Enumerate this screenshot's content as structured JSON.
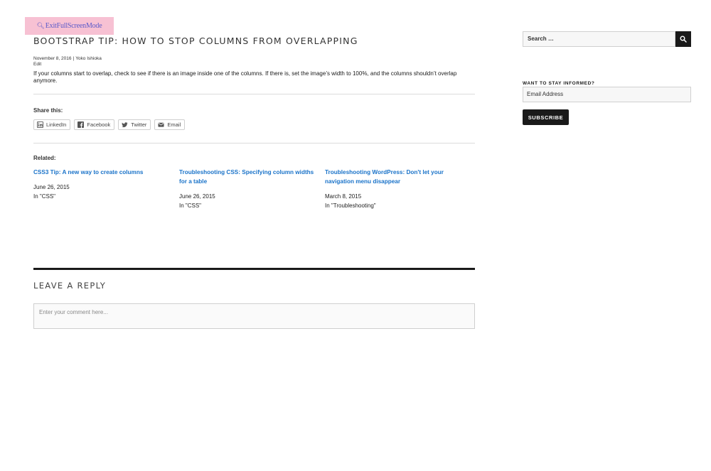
{
  "fullscreen": {
    "label": "ExitFullScreenMode"
  },
  "post": {
    "title": "BOOTSTRAP TIP: HOW TO STOP COLUMNS FROM OVERLAPPING",
    "date": "November 8, 2016",
    "author": "Yoko Ishioka",
    "meta_separator": "|",
    "edit_label": "Edit",
    "body": "If your columns start to overlap, check to see if there is an image inside one of the columns. If there is, set the image’s width to 100%, and the columns shouldn’t overlap anymore."
  },
  "share": {
    "heading": "Share this:",
    "buttons": [
      {
        "label": "LinkedIn",
        "icon": "linkedin-icon"
      },
      {
        "label": "Facebook",
        "icon": "facebook-icon"
      },
      {
        "label": "Twitter",
        "icon": "twitter-icon"
      },
      {
        "label": "Email",
        "icon": "email-icon"
      }
    ]
  },
  "related": {
    "heading": "Related:",
    "items": [
      {
        "title": "CSS3 Tip: A new way to create columns",
        "date": "June 26, 2015",
        "category": "In \"CSS\""
      },
      {
        "title": "Troubleshooting CSS: Specifying column widths for a table",
        "date": "June 26, 2015",
        "category": "In \"CSS\""
      },
      {
        "title": "Troubleshooting WordPress: Don't let your navigation menu disappear",
        "date": "March 8, 2015",
        "category": "In \"Troubleshooting\""
      }
    ]
  },
  "reply": {
    "heading": "LEAVE A REPLY",
    "placeholder": "Enter your comment here..."
  },
  "sidebar": {
    "search_placeholder": "Search …",
    "newsletter_heading": "WANT TO STAY INFORMED?",
    "email_placeholder": "Email Address",
    "subscribe_label": "SUBSCRIBE"
  },
  "colors": {
    "link": "#1a73c9",
    "dark": "#1a1a1a",
    "fullscreen_bg": "#f7c1d3"
  }
}
